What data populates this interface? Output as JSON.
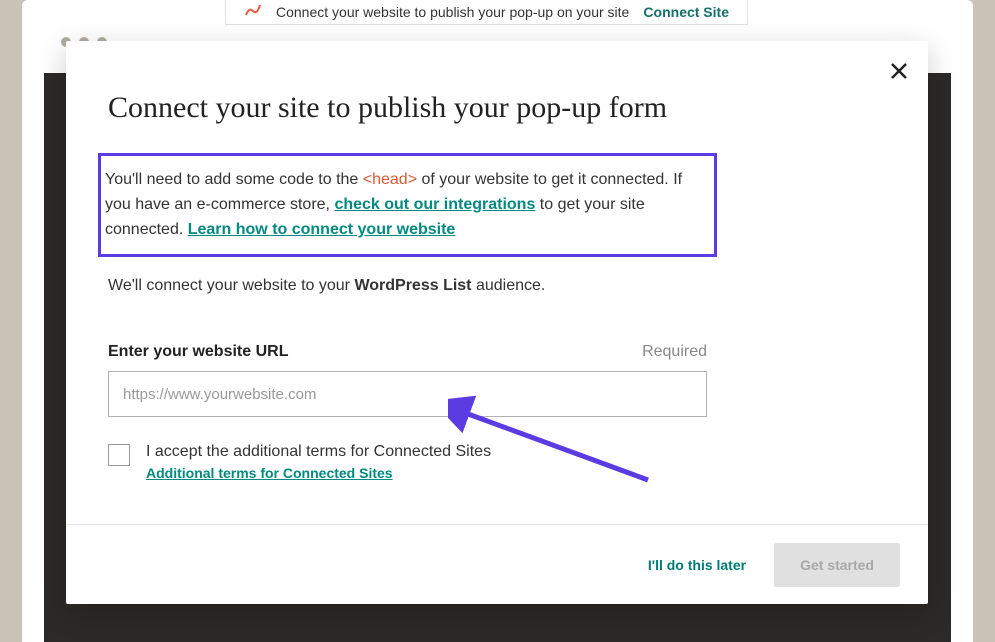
{
  "notice": {
    "text": "Connect your website to publish your pop-up on your site",
    "action": "Connect Site"
  },
  "modal": {
    "title": "Connect your site to publish your pop-up form",
    "desc_part1": "You'll need to add some code to the ",
    "desc_code": "<head>",
    "desc_part2": " of your website to get it connected. If you have an e-commerce store, ",
    "desc_link1": "check out our integrations",
    "desc_part3": " to get your site connected. ",
    "desc_link2": "Learn how to connect your website",
    "audience_prefix": "We'll connect your website to your ",
    "audience_name": "WordPress List",
    "audience_suffix": " audience.",
    "url_label": "Enter your website URL",
    "required": "Required",
    "url_placeholder": "https://www.yourwebsite.com",
    "checkbox_label": "I accept the additional terms for Connected Sites",
    "terms_link": "Additional terms for Connected Sites",
    "later_button": "I'll do this later",
    "get_started": "Get started"
  }
}
